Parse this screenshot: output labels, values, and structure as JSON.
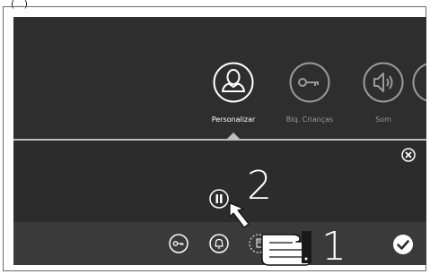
{
  "top_partial_text": "(...)",
  "settings": [
    {
      "label": "Personalizar",
      "icon": "user-icon",
      "active": true
    },
    {
      "label": "Blq. Crianças",
      "icon": "key-icon",
      "active": false
    },
    {
      "label": "Som",
      "icon": "speaker-icon",
      "active": false
    }
  ],
  "bottom_bar": {
    "icons": [
      "key-icon",
      "bell-icon",
      "hand-card-icon"
    ],
    "confirm_icon": "check-icon"
  },
  "annotations": {
    "step_1": "1",
    "step_2": "2"
  },
  "colors": {
    "screen_bg": "#2b2b2b",
    "bar_bg": "#3a3a3a",
    "accent_white": "#ffffff",
    "muted_label": "#9a9a9a"
  }
}
